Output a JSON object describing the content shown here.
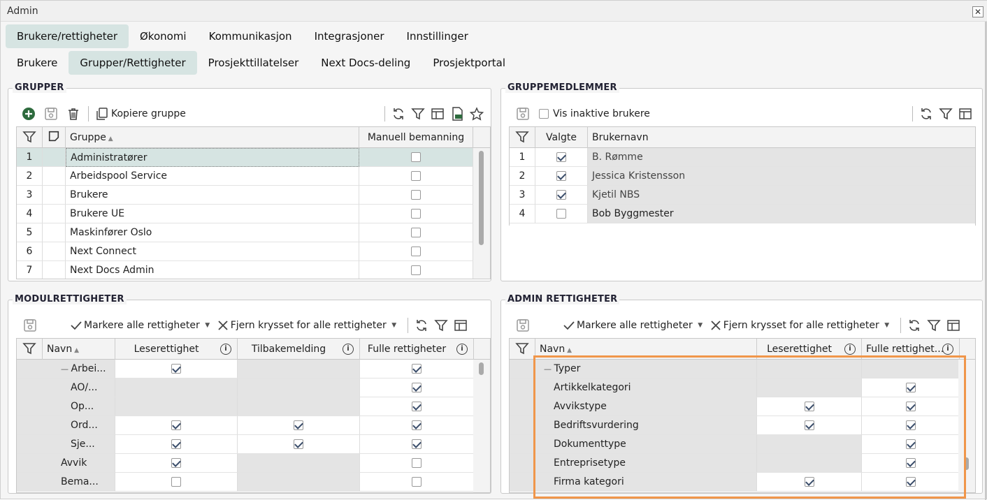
{
  "window": {
    "title": "Admin",
    "close_icon": "close-icon"
  },
  "main_tabs": [
    "Brukere/rettigheter",
    "Økonomi",
    "Kommunikasjon",
    "Integrasjoner",
    "Innstillinger"
  ],
  "sub_tabs": [
    "Brukere",
    "Grupper/Rettigheter",
    "Prosjekttillatelser",
    "Next Docs-deling",
    "Prosjektportal"
  ],
  "grupper": {
    "title": "GRUPPER",
    "copy_label": "Kopiere gruppe",
    "headers": {
      "gruppe": "Gruppe",
      "manuell": "Manuell bemanning"
    },
    "rows": [
      {
        "n": "1",
        "name": "Administratører",
        "checked": false
      },
      {
        "n": "2",
        "name": "Arbeidspool Service",
        "checked": false
      },
      {
        "n": "3",
        "name": "Brukere",
        "checked": false
      },
      {
        "n": "4",
        "name": "Brukere UE",
        "checked": false
      },
      {
        "n": "5",
        "name": "Maskinfører Oslo",
        "checked": false
      },
      {
        "n": "6",
        "name": "Next Connect",
        "checked": false
      },
      {
        "n": "7",
        "name": "Next Docs Admin",
        "checked": false
      }
    ]
  },
  "medlemmer": {
    "title": "GRUPPEMEDLEMMER",
    "inactive_label": "Vis inaktive brukere",
    "headers": {
      "valgte": "Valgte",
      "brukernavn": "Brukernavn"
    },
    "rows": [
      {
        "n": "1",
        "name": "B. Rømme",
        "checked": true
      },
      {
        "n": "2",
        "name": "Jessica Kristensson",
        "checked": true
      },
      {
        "n": "3",
        "name": "Kjetil NBS",
        "checked": true
      },
      {
        "n": "4",
        "name": "Bob Byggmester",
        "checked": false
      }
    ]
  },
  "modul": {
    "title": "MODULRETTIGHETER",
    "mark_all": "Markere alle rettigheter",
    "unmark_all": "Fjern krysset for alle rettigheter",
    "headers": {
      "navn": "Navn",
      "lese": "Leserettighet",
      "tilbake": "Tilbakemelding",
      "fulle": "Fulle rettigheter"
    },
    "rows": [
      {
        "name": "Arbei...",
        "indent": 1,
        "expand": "—",
        "lese": "on",
        "tilbake": "gray",
        "fulle": "on"
      },
      {
        "name": "AO/...",
        "indent": 2,
        "lese": "gray",
        "tilbake": "gray",
        "fulle": "on"
      },
      {
        "name": "Op...",
        "indent": 2,
        "lese": "gray",
        "tilbake": "gray",
        "fulle": "on"
      },
      {
        "name": "Ord...",
        "indent": 2,
        "lese": "on",
        "tilbake": "on",
        "fulle": "on"
      },
      {
        "name": "Sje...",
        "indent": 2,
        "lese": "on",
        "tilbake": "on",
        "fulle": "on"
      },
      {
        "name": "Avvik",
        "indent": 1,
        "lese": "on",
        "tilbake": "gray",
        "fulle": "off"
      },
      {
        "name": "Bema...",
        "indent": 1,
        "lese": "off",
        "tilbake": "gray",
        "fulle": "off"
      }
    ]
  },
  "admin": {
    "title": "ADMIN RETTIGHETER",
    "mark_all": "Markere alle rettigheter",
    "unmark_all": "Fjern krysset for alle rettigheter",
    "headers": {
      "navn": "Navn",
      "lese": "Leserettighet",
      "fulle": "Fulle rettighet..."
    },
    "rows": [
      {
        "name": "Typer",
        "indent": 0,
        "expand": "—",
        "lese": "gray",
        "fulle": "gray"
      },
      {
        "name": "Artikkelkategori",
        "indent": 1,
        "lese": "gray",
        "fulle": "on"
      },
      {
        "name": "Avvikstype",
        "indent": 1,
        "lese": "on",
        "fulle": "on"
      },
      {
        "name": "Bedriftsvurdering",
        "indent": 1,
        "lese": "on",
        "fulle": "on"
      },
      {
        "name": "Dokumenttype",
        "indent": 1,
        "lese": "gray",
        "fulle": "on"
      },
      {
        "name": "Entreprisetype",
        "indent": 1,
        "lese": "gray",
        "fulle": "on"
      },
      {
        "name": "Firma kategori",
        "indent": 1,
        "lese": "on",
        "fulle": "on"
      }
    ]
  }
}
